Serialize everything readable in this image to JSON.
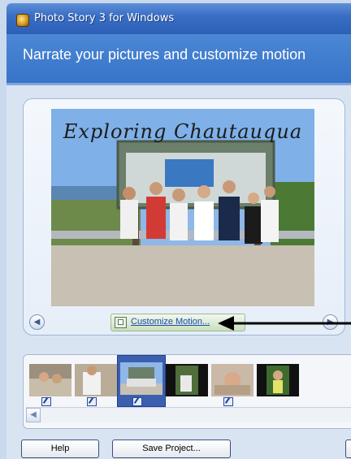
{
  "window": {
    "title": "Photo Story 3 for Windows",
    "app_icon": "photo-story-icon"
  },
  "header": {
    "title": "Narrate your pictures and customize motion"
  },
  "preview": {
    "caption": "Exploring Chautauqua",
    "prev_icon": "chevron-left-circle-icon",
    "next_icon": "chevron-right-circle-icon",
    "customize_label": "Customize Motion..."
  },
  "filmstrip": {
    "selected_index": 2,
    "thumbnails": [
      {
        "name": "thumb-1",
        "edited": true
      },
      {
        "name": "thumb-2",
        "edited": true
      },
      {
        "name": "thumb-3",
        "edited": true
      },
      {
        "name": "thumb-4",
        "edited": false
      },
      {
        "name": "thumb-5",
        "edited": true
      },
      {
        "name": "thumb-6",
        "edited": false
      }
    ]
  },
  "buttons": {
    "help_label": "Help",
    "save_label": "Save Project..."
  },
  "colors": {
    "title_bar": "#3a6fc6",
    "header_band": "#3774c8",
    "selected_thumb": "#3c5fb0",
    "link": "#1a4cad"
  }
}
